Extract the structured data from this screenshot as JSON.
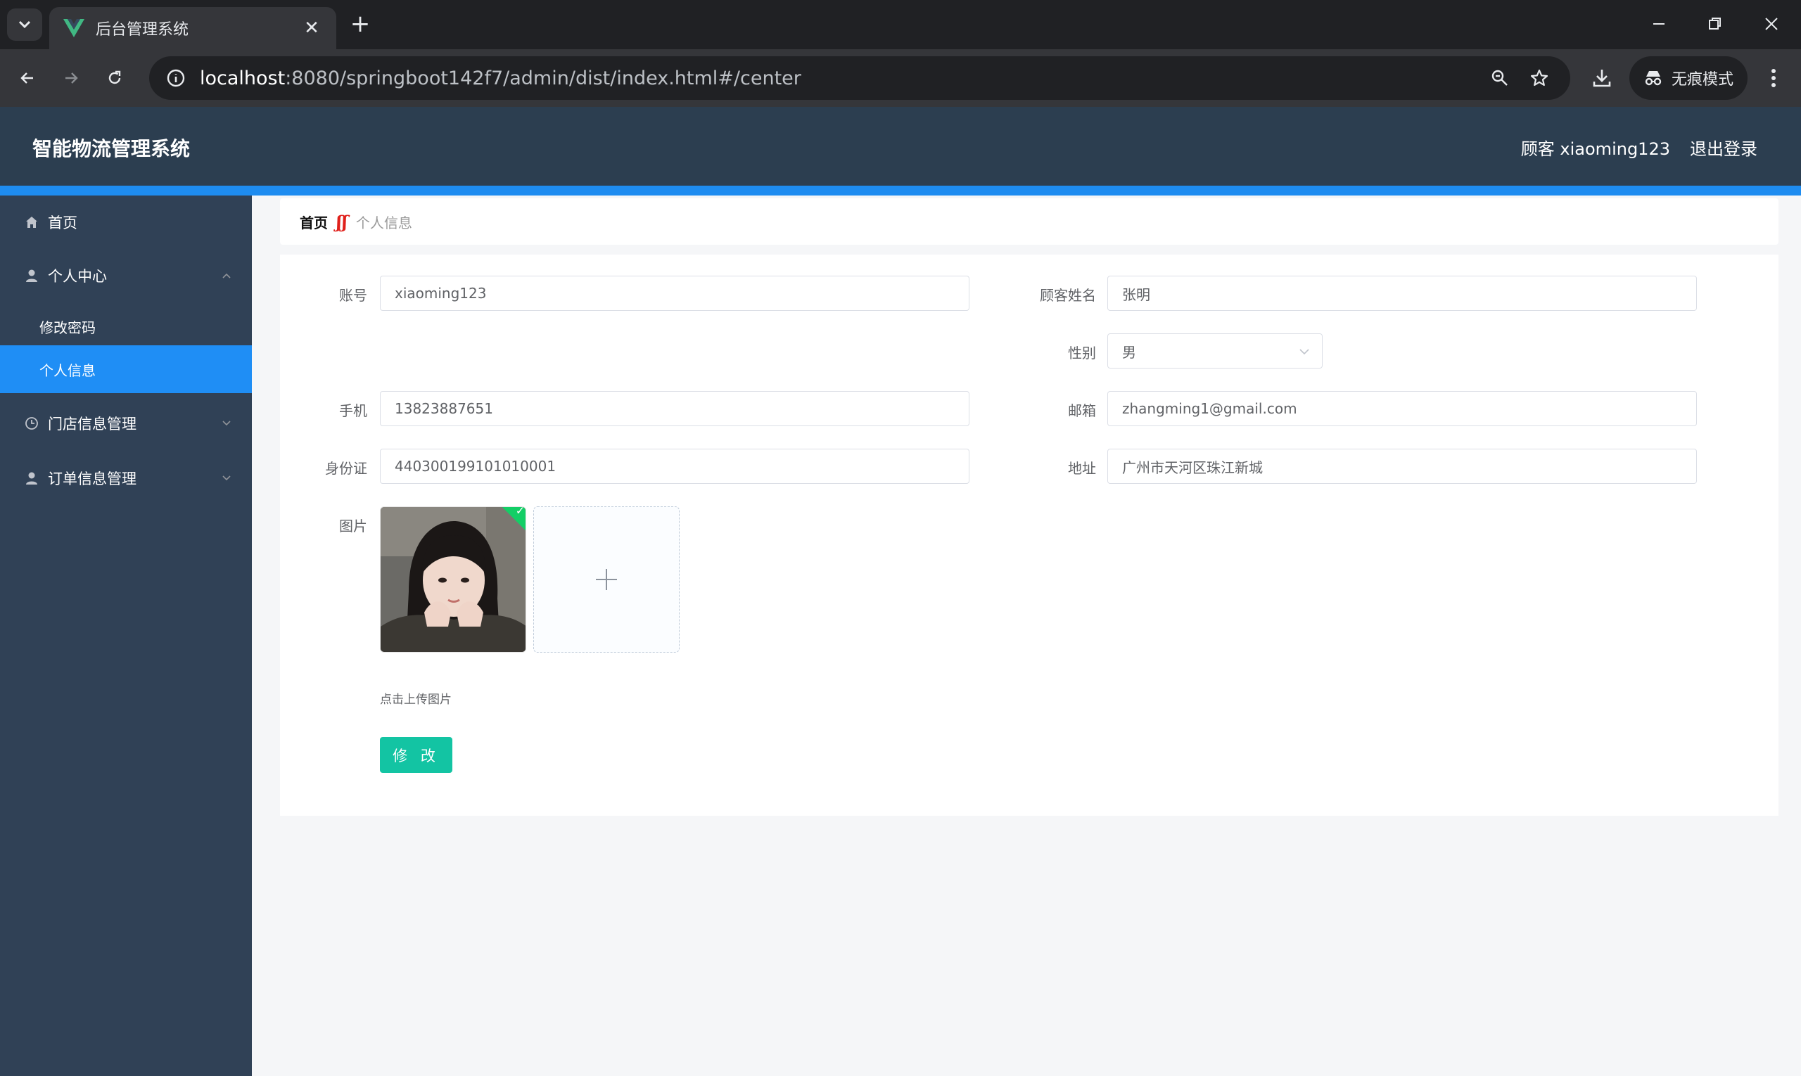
{
  "browser": {
    "tab_title": "后台管理系统",
    "url_host": "localhost",
    "url_path": ":8080/springboot142f7/admin/dist/index.html#/center",
    "incognito_label": "无痕模式"
  },
  "header": {
    "app_title": "智能物流管理系统",
    "user_label": "顾客 xiaoming123",
    "logout_label": "退出登录"
  },
  "sidebar": {
    "items": [
      {
        "label": "首页",
        "icon": "home-icon"
      },
      {
        "label": "个人中心",
        "icon": "user-icon",
        "expanded": true,
        "children": [
          {
            "label": "修改密码"
          },
          {
            "label": "个人信息",
            "active": true
          }
        ]
      },
      {
        "label": "门店信息管理",
        "icon": "clock-icon"
      },
      {
        "label": "订单信息管理",
        "icon": "user-icon"
      }
    ]
  },
  "breadcrumb": {
    "home": "首页",
    "current": "个人信息"
  },
  "form": {
    "account": {
      "label": "账号",
      "value": "xiaoming123"
    },
    "customer_name": {
      "label": "顾客姓名",
      "value": "张明"
    },
    "gender": {
      "label": "性别",
      "value": "男"
    },
    "phone": {
      "label": "手机",
      "value": "13823887651"
    },
    "email": {
      "label": "邮箱",
      "value": "zhangming1@gmail.com"
    },
    "id_card": {
      "label": "身份证",
      "value": "440300199101010001"
    },
    "address": {
      "label": "地址",
      "value": "广州市天河区珠江新城"
    },
    "picture": {
      "label": "图片",
      "upload_tip": "点击上传图片"
    },
    "submit_label": "修 改"
  },
  "colors": {
    "header_bg": "#2c3e50",
    "sidebar_bg": "#304156",
    "accent_blue": "#1f8ef5",
    "submit_green": "#13c4a3"
  }
}
